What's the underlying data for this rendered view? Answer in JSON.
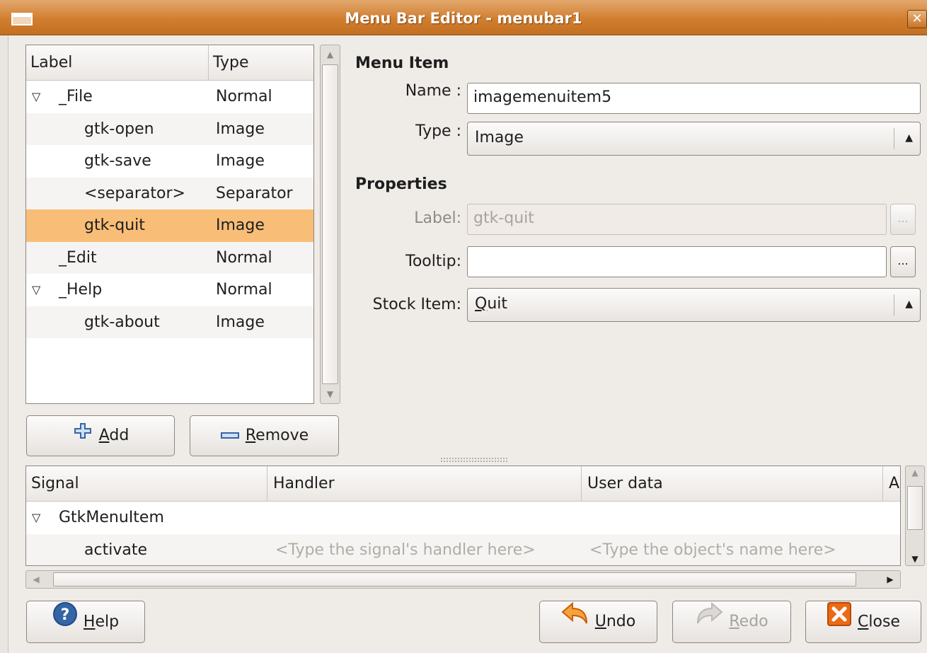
{
  "window": {
    "title": "Menu Bar Editor - menubar1",
    "close_glyph": "✕"
  },
  "tree": {
    "headers": {
      "label": "Label",
      "type": "Type"
    },
    "rows": [
      {
        "label": "_File",
        "type": "Normal",
        "expander": "▽",
        "indent": 0
      },
      {
        "label": "gtk-open",
        "type": "Image",
        "expander": "",
        "indent": 1
      },
      {
        "label": "gtk-save",
        "type": "Image",
        "expander": "",
        "indent": 1
      },
      {
        "label": "<separator>",
        "type": "Separator",
        "expander": "",
        "indent": 1
      },
      {
        "label": "gtk-quit",
        "type": "Image",
        "expander": "",
        "indent": 1,
        "selected": true
      },
      {
        "label": "_Edit",
        "type": "Normal",
        "expander": "",
        "indent": 0
      },
      {
        "label": "_Help",
        "type": "Normal",
        "expander": "▽",
        "indent": 0
      },
      {
        "label": "gtk-about",
        "type": "Image",
        "expander": "",
        "indent": 1
      }
    ]
  },
  "buttons": {
    "add": {
      "mnemonic": "A",
      "rest": "dd",
      "icon": "plus-icon"
    },
    "remove": {
      "mnemonic": "R",
      "rest": "emove",
      "icon": "minus-icon"
    },
    "help": {
      "mnemonic": "H",
      "rest": "elp",
      "icon": "help-icon"
    },
    "undo": {
      "mnemonic": "U",
      "rest": "ndo",
      "icon": "undo-icon"
    },
    "redo": {
      "mnemonic": "R",
      "rest": "edo",
      "icon": "redo-icon"
    },
    "close": {
      "mnemonic": "C",
      "rest": "lose",
      "icon": "close-icon"
    }
  },
  "menu_item": {
    "section_title": "Menu Item",
    "name_label": "Name :",
    "name_value": "imagemenuitem5",
    "type_label": "Type :",
    "type_value": "Image"
  },
  "properties": {
    "section_title": "Properties",
    "label_label": "Label:",
    "label_value": "gtk-quit",
    "tooltip_label": "Tooltip:",
    "tooltip_value": "",
    "stock_label": "Stock Item:",
    "stock_mnemonic": "Q",
    "stock_rest": "uit",
    "ellipsis": "..."
  },
  "signals": {
    "headers": {
      "signal": "Signal",
      "handler": "Handler",
      "user_data": "User data",
      "after": "A"
    },
    "group": {
      "expander": "▽",
      "name": "GtkMenuItem"
    },
    "rows": [
      {
        "signal": "activate",
        "handler_placeholder": "<Type the signal's handler here>",
        "user_data_placeholder": "<Type the object's name here>"
      }
    ]
  },
  "colors": {
    "titlebar": "#d17e2f",
    "selection": "#f8be78",
    "window_bg": "#efebe7"
  }
}
